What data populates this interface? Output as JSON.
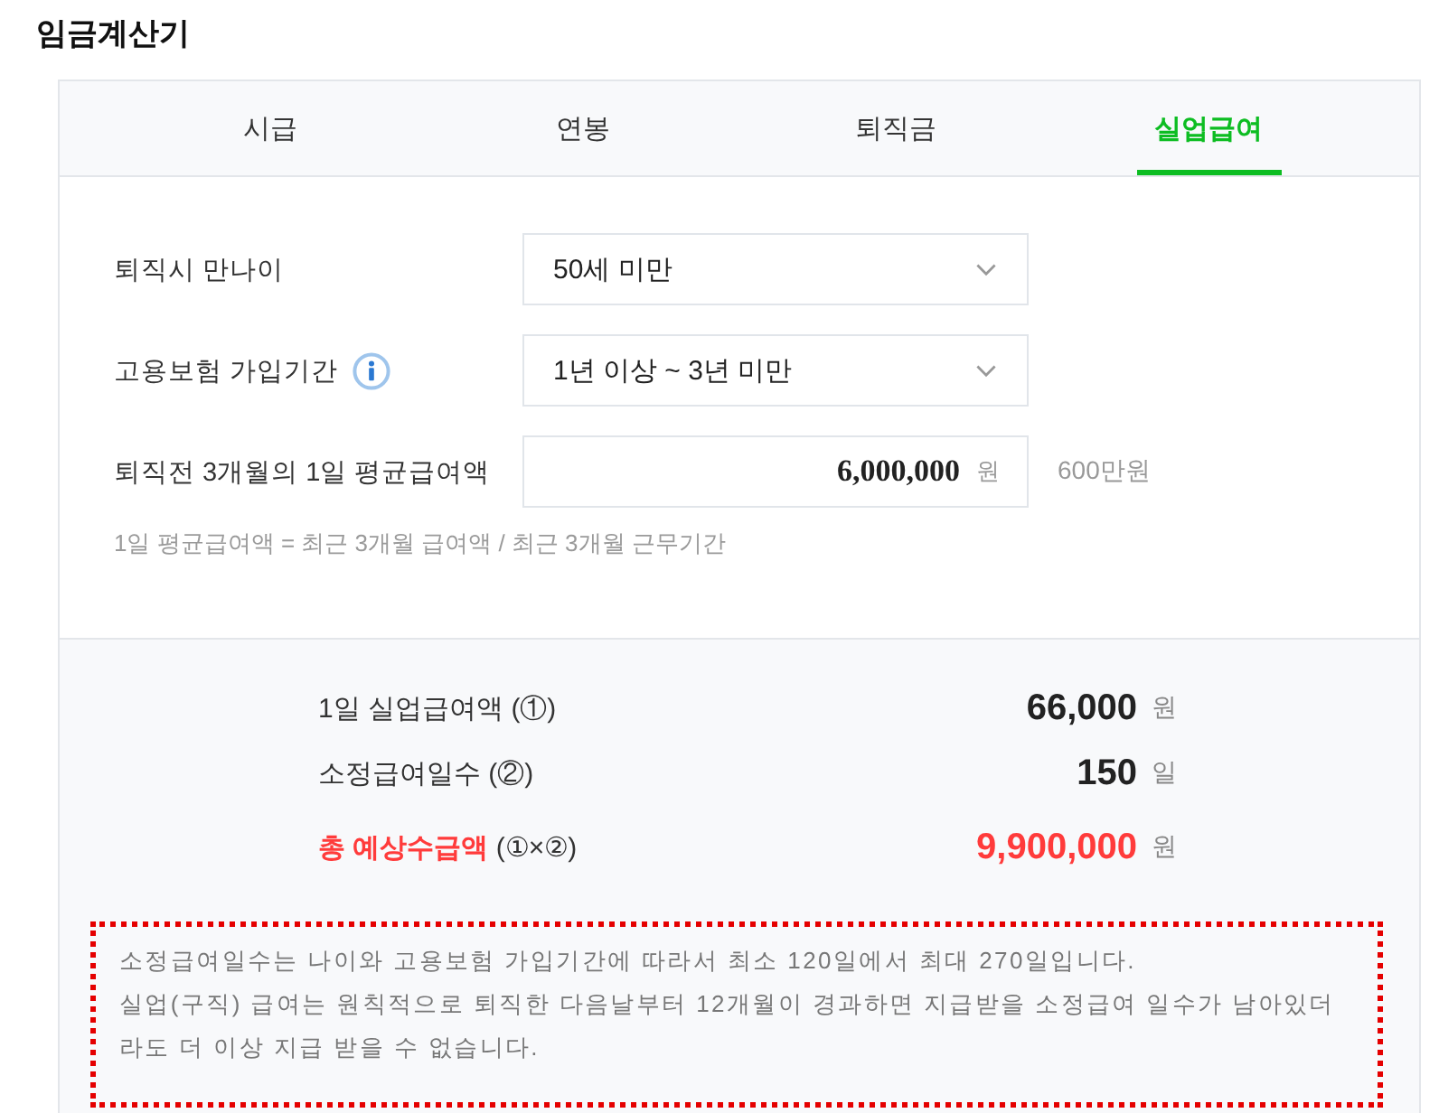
{
  "title": "임금계산기",
  "tabs": [
    {
      "label": "시급",
      "selected": false
    },
    {
      "label": "연봉",
      "selected": false
    },
    {
      "label": "퇴직금",
      "selected": false
    },
    {
      "label": "실업급여",
      "selected": true
    }
  ],
  "form": {
    "fields": [
      {
        "kind": "select",
        "label": "퇴직시 만나이",
        "value": "50세 미만"
      },
      {
        "kind": "select",
        "label": "고용보험 가입기간",
        "info": true,
        "value": "1년 이상 ~ 3년 미만"
      },
      {
        "kind": "amount",
        "label": "퇴직전 3개월의 1일 평균급여액",
        "value": "6,000,000",
        "unit": "원",
        "reading": "600만원"
      }
    ],
    "hint": "1일 평균급여액 = 최근 3개월 급여액 / 최근 3개월 근무기간"
  },
  "results": [
    {
      "label": "1일 실업급여액",
      "ref": "(①)",
      "value": "66,000",
      "unit": "원",
      "highlight": false
    },
    {
      "label": "소정급여일수",
      "ref": "(②)",
      "value": "150",
      "unit": "일",
      "highlight": false
    },
    {
      "label": "총 예상수급액",
      "ref": "(①×②)",
      "value": "9,900,000",
      "unit": "원",
      "highlight": true
    }
  ],
  "notice": {
    "highlighted": true,
    "paragraphs": [
      "소정급여일수는 나이와 고용보험 가입기간에 따라서 최소 120일에서 최대 270일입니다.",
      "실업(구직) 급여는 원칙적으로 퇴직한 다음날부터 12개월이 경과하면 지급받을 소정급여 일수가 남아있더라도 더 이상 지급 받을 수 없습니다."
    ]
  }
}
